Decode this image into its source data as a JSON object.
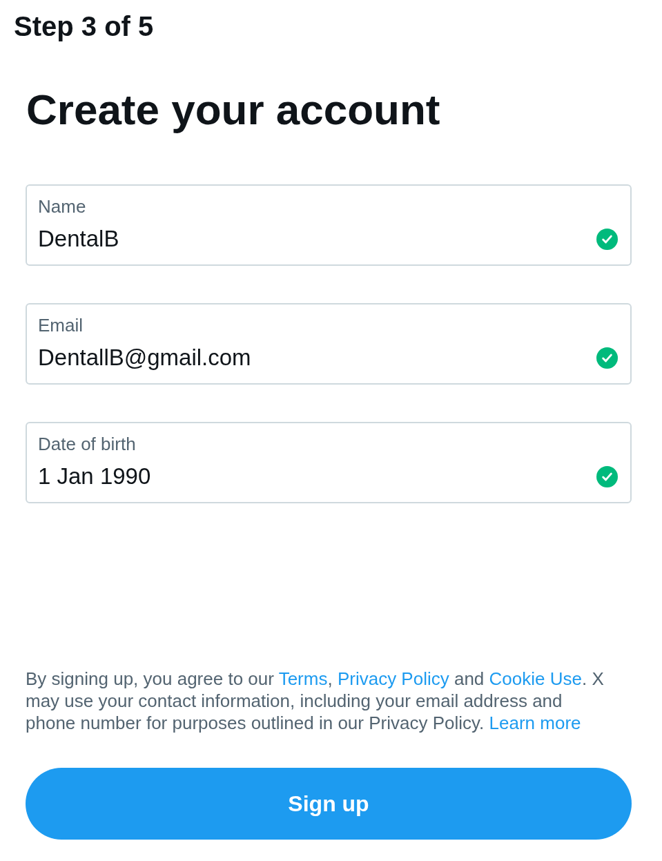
{
  "step": "Step 3 of 5",
  "title": "Create your account",
  "fields": [
    {
      "label": "Name",
      "value": "DentalB",
      "valid": true
    },
    {
      "label": "Email",
      "value": "DentallB@gmail.com",
      "valid": true
    },
    {
      "label": "Date of birth",
      "value": "1 Jan 1990",
      "valid": true
    }
  ],
  "legal": {
    "segments": [
      {
        "kind": "text",
        "text": "By signing up, you agree to our "
      },
      {
        "kind": "link",
        "text": "Terms"
      },
      {
        "kind": "text",
        "text": ", "
      },
      {
        "kind": "link",
        "text": "Privacy Policy"
      },
      {
        "kind": "text",
        "text": " and "
      },
      {
        "kind": "link",
        "text": "Cookie Use"
      },
      {
        "kind": "text",
        "text": ". X may use your contact information, including your email address and phone number for purposes outlined in our Privacy Policy. "
      },
      {
        "kind": "link",
        "text": "Learn more"
      }
    ]
  },
  "primary_button": {
    "label": "Sign up"
  }
}
